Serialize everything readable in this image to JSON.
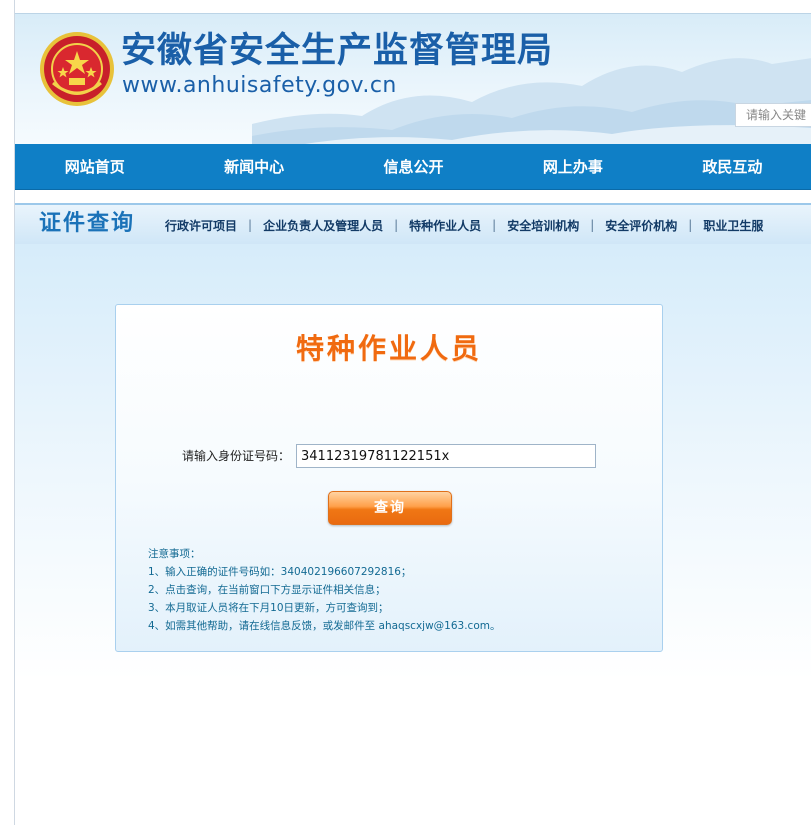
{
  "header": {
    "site_title": "安徽省安全生产监督管理局",
    "site_url": "www.anhuisafety.gov.cn",
    "search_placeholder": "请输入关键"
  },
  "nav": {
    "items": [
      {
        "label": "网站首页"
      },
      {
        "label": "新闻中心"
      },
      {
        "label": "信息公开"
      },
      {
        "label": "网上办事"
      },
      {
        "label": "政民互动"
      }
    ]
  },
  "subbar": {
    "title": "证件查询",
    "links": [
      {
        "label": "行政许可项目"
      },
      {
        "label": "企业负责人及管理人员"
      },
      {
        "label": "特种作业人员"
      },
      {
        "label": "安全培训机构"
      },
      {
        "label": "安全评价机构"
      },
      {
        "label": "职业卫生服"
      }
    ],
    "separator": "|"
  },
  "panel": {
    "title": "特种作业人员",
    "id_label": "请输入身份证号码：",
    "id_value": "34112319781122151x",
    "query_button": "查询",
    "notes_title": "注意事项：",
    "notes": [
      "1、输入正确的证件号码如：340402196607292816；",
      "2、点击查询，在当前窗口下方显示证件相关信息；",
      "3、本月取证人员将在下月10日更新，方可查询到；",
      "4、如需其他帮助，请在线信息反馈，或发邮件至 ahaqscxjw@163.com。"
    ]
  },
  "colors": {
    "nav_bg": "#0f7fc6",
    "title_blue": "#1a5fa8",
    "panel_title_orange": "#f06a10",
    "notes_text": "#136a93"
  }
}
